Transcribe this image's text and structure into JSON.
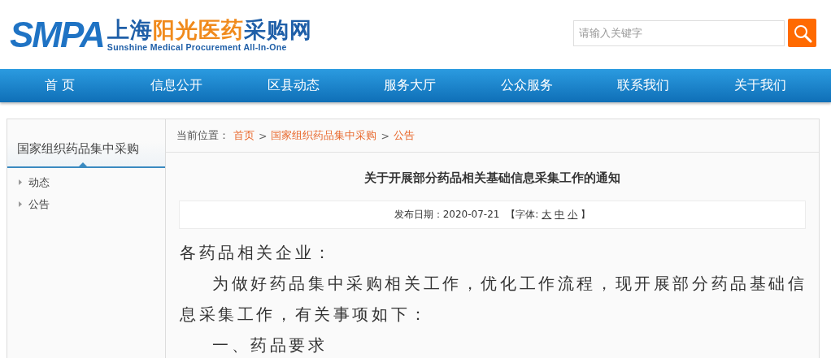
{
  "logo": {
    "mark": "SMPA",
    "title_parts": [
      {
        "text": "上海",
        "color": "#1f5fa8"
      },
      {
        "text": "阳光医药",
        "color": "#f08a1c"
      },
      {
        "text": "采购网",
        "color": "#1f5fa8"
      }
    ],
    "subtitle": "Sunshine Medical Procurement All-In-One"
  },
  "search": {
    "placeholder": "请输入关键字"
  },
  "nav": [
    {
      "label": "首 页"
    },
    {
      "label": "信息公开"
    },
    {
      "label": "区县动态"
    },
    {
      "label": "服务大厅"
    },
    {
      "label": "公众服务"
    },
    {
      "label": "联系我们"
    },
    {
      "label": "关于我们"
    }
  ],
  "sidebar": {
    "title": "国家组织药品集中采购",
    "items": [
      {
        "label": "动态"
      },
      {
        "label": "公告"
      }
    ]
  },
  "breadcrumb": {
    "prefix": "当前位置：",
    "items": [
      {
        "label": "首页"
      },
      {
        "label": "国家组织药品集中采购"
      },
      {
        "label": "公告"
      }
    ],
    "separator": ">"
  },
  "article": {
    "title": "关于开展部分药品相关基础信息采集工作的通知",
    "date_label": "发布日期：2020-07-21",
    "font_label_open": "【字体:",
    "font_sizes": [
      "大",
      "中",
      "小"
    ],
    "font_label_close": "】",
    "paragraphs": [
      {
        "text": "各药品相关企业：",
        "indent": false
      },
      {
        "text": "为做好药品集中采购相关工作，优化工作流程，现开展部分药品基础信息采集工作，有关事项如下：",
        "indent": true
      },
      {
        "text": "一、药品要求",
        "indent": true
      }
    ]
  }
}
